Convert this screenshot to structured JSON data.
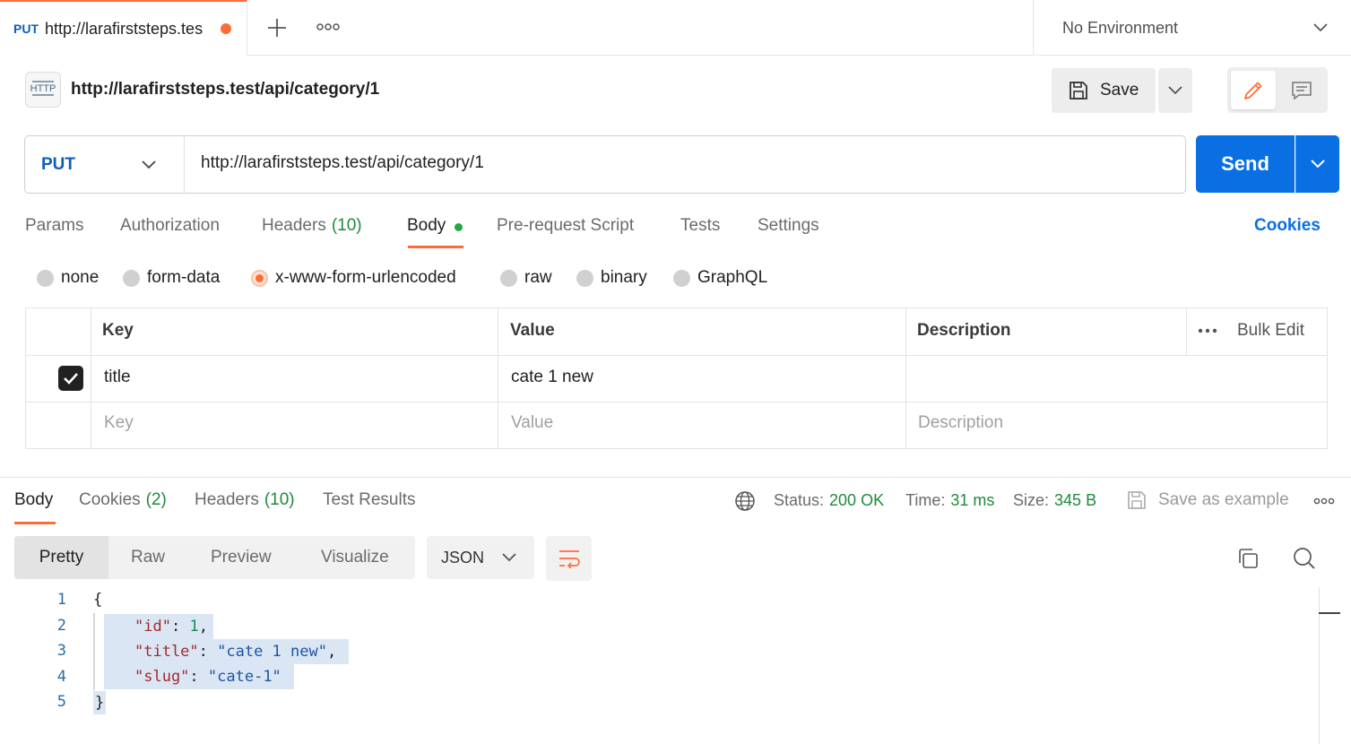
{
  "tab": {
    "method": "PUT",
    "title": "http://larafirststeps.tes"
  },
  "environment": {
    "label": "No Environment"
  },
  "request": {
    "icon_text": "HTTP",
    "title": "http://larafirststeps.test/api/category/1",
    "save_label": "Save",
    "method": "PUT",
    "url": "http://larafirststeps.test/api/category/1",
    "send_label": "Send"
  },
  "request_tabs": {
    "params": "Params",
    "authorization": "Authorization",
    "headers": "Headers",
    "headers_count": "(10)",
    "body": "Body",
    "pre_request": "Pre-request Script",
    "tests": "Tests",
    "settings": "Settings",
    "cookies": "Cookies"
  },
  "body_types": {
    "none": "none",
    "form_data": "form-data",
    "urlencoded": "x-www-form-urlencoded",
    "raw": "raw",
    "binary": "binary",
    "graphql": "GraphQL",
    "selected": "x-www-form-urlencoded"
  },
  "params_table": {
    "headers": {
      "key": "Key",
      "value": "Value",
      "description": "Description",
      "bulk_edit": "Bulk Edit"
    },
    "rows": [
      {
        "checked": true,
        "key": "title",
        "value": "cate 1 new",
        "description": ""
      }
    ],
    "placeholders": {
      "key": "Key",
      "value": "Value",
      "description": "Description"
    }
  },
  "response_tabs": {
    "body": "Body",
    "cookies": "Cookies",
    "cookies_count": "(2)",
    "headers": "Headers",
    "headers_count": "(10)",
    "test_results": "Test Results"
  },
  "response_meta": {
    "status_label": "Status:",
    "status_value": "200 OK",
    "time_label": "Time:",
    "time_value": "31 ms",
    "size_label": "Size:",
    "size_value": "345 B",
    "save_example": "Save as example"
  },
  "view_modes": {
    "pretty": "Pretty",
    "raw": "Raw",
    "preview": "Preview",
    "visualize": "Visualize",
    "format": "JSON"
  },
  "code": {
    "line_numbers": [
      "1",
      "2",
      "3",
      "4",
      "5"
    ],
    "open_brace": "{",
    "close_brace": "}",
    "key_id": "\"id\"",
    "val_id": "1",
    "key_title": "\"title\"",
    "val_title": "\"cate 1 new\"",
    "key_slug": "\"slug\"",
    "val_slug": "\"cate-1\""
  },
  "colors": {
    "accent": "#ff6c37",
    "primary": "#0a6fe3",
    "success": "#1f8a3b"
  }
}
